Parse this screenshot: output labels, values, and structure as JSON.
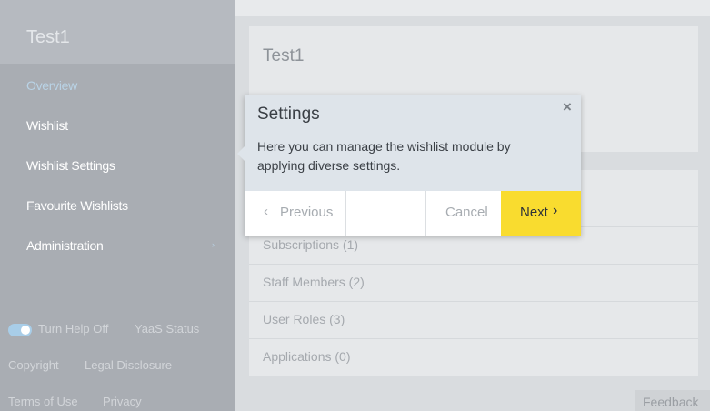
{
  "sidebar": {
    "project_title": "Test1",
    "nav": [
      {
        "label": "Overview",
        "active": true
      },
      {
        "label": "Wishlist"
      },
      {
        "label": "Wishlist Settings"
      },
      {
        "label": "Favourite Wishlists"
      },
      {
        "label": "Administration"
      }
    ],
    "administration_arrow": "›",
    "help_toggle_label": "Turn Help Off",
    "yaas_status": "YaaS Status",
    "footer_links": [
      "Copyright",
      "Legal Disclosure",
      "Terms of Use",
      "Privacy"
    ]
  },
  "main": {
    "card_title": "Test1",
    "rows": [
      "Subscriptions (1)",
      "Staff Members (2)",
      "User Roles (3)",
      "Applications (0)"
    ]
  },
  "popover": {
    "title": "Settings",
    "close_glyph": "×",
    "body": "Here you can manage the wishlist module by applying diverse settings.",
    "previous_label": "Previous",
    "cancel_label": "Cancel",
    "next_label": "Next",
    "prev_chevron": "‹",
    "next_chevron": "›"
  },
  "feedback_label": "Feedback",
  "colors": {
    "sidebar_bg": "#a9adb3",
    "accent_yellow": "#f9dc2f",
    "active_nav": "#b9d3e6",
    "toggle": "#a8cde8"
  }
}
